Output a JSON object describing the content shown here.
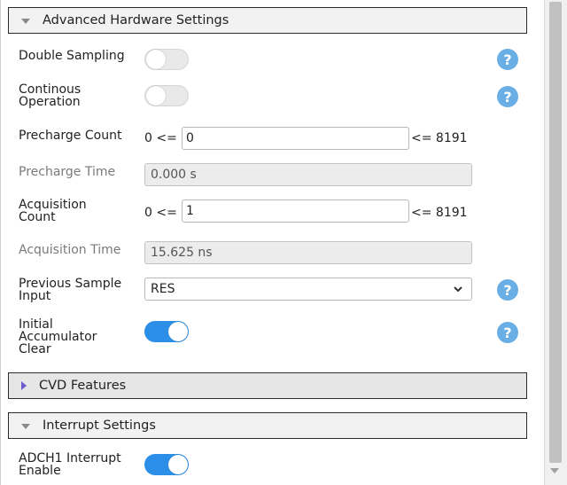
{
  "sections": {
    "advanced": {
      "title": "Advanced Hardware Settings"
    },
    "cvd": {
      "title": "CVD Features"
    },
    "interrupt": {
      "title": "Interrupt Settings"
    }
  },
  "fields": {
    "double_sampling": {
      "label": "Double Sampling",
      "enabled": false
    },
    "continuous_operation": {
      "label": "Continous Operation",
      "enabled": false
    },
    "precharge_count": {
      "label": "Precharge Count",
      "min_label": "0 <=",
      "value": "0",
      "max_label": "<= 8191"
    },
    "precharge_time": {
      "label": "Precharge Time",
      "value": "0.000 s"
    },
    "acquisition_count": {
      "label": "Acquisition Count",
      "min_label": "0 <=",
      "value": "1",
      "max_label": "<= 8191"
    },
    "acquisition_time": {
      "label": "Acquisition Time",
      "value": "15.625 ns"
    },
    "previous_sample_input": {
      "label": "Previous Sample Input",
      "value": "RES"
    },
    "initial_accumulator_clear": {
      "label": "Initial Accumulator Clear",
      "enabled": true
    },
    "adch1_interrupt_enable": {
      "label": "ADCH1 Interrupt Enable",
      "enabled": true
    }
  },
  "help_glyph": "?",
  "icons": {
    "help": "help-icon",
    "expanded": "triangle-down-icon",
    "collapsed": "triangle-right-icon",
    "dropdown": "chevron-down-icon"
  },
  "colors": {
    "toggle_on": "#2b8fe8",
    "toggle_off": "#e9e9e9",
    "help": "#6aaee6",
    "collapsed_triangle": "#6a5acd"
  }
}
